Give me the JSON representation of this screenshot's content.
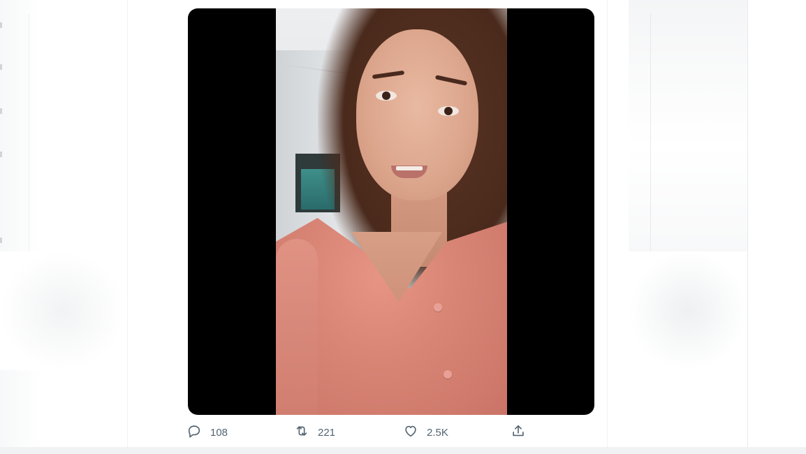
{
  "tweet": {
    "actions": {
      "reply_count": "108",
      "retweet_count": "221",
      "like_count": "2.5K"
    }
  },
  "colors": {
    "icon_gray": "#536471",
    "accent_blue": "#1d9bf0",
    "video_bg": "#000000"
  },
  "icons": [
    "reply-icon",
    "retweet-icon",
    "like-icon",
    "share-icon"
  ]
}
